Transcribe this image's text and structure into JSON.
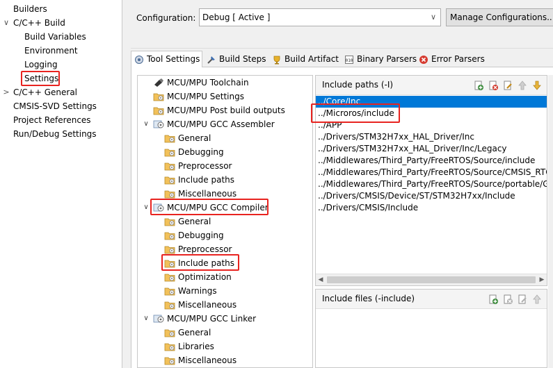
{
  "left_nav": {
    "items": [
      {
        "label": "Builders",
        "indent": 0,
        "arrow": ""
      },
      {
        "label": "C/C++ Build",
        "indent": 0,
        "arrow": "∨"
      },
      {
        "label": "Build Variables",
        "indent": 1,
        "arrow": ""
      },
      {
        "label": "Environment",
        "indent": 1,
        "arrow": ""
      },
      {
        "label": "Logging",
        "indent": 1,
        "arrow": ""
      },
      {
        "label": "Settings",
        "indent": 1,
        "arrow": "",
        "highlight": true
      },
      {
        "label": "C/C++ General",
        "indent": 0,
        "arrow": ">"
      },
      {
        "label": "CMSIS-SVD Settings",
        "indent": 0,
        "arrow": ""
      },
      {
        "label": "Project References",
        "indent": 0,
        "arrow": ""
      },
      {
        "label": "Run/Debug Settings",
        "indent": 0,
        "arrow": ""
      }
    ]
  },
  "config": {
    "label": "Configuration:",
    "value": "Debug  [ Active ]",
    "manage_label": "Manage Configurations..."
  },
  "tabs": [
    {
      "label": "Tool Settings",
      "icon": "tool-settings-icon",
      "active": true
    },
    {
      "label": "Build Steps",
      "icon": "build-steps-icon",
      "active": false
    },
    {
      "label": "Build Artifact",
      "icon": "build-artifact-icon",
      "active": false
    },
    {
      "label": "Binary Parsers",
      "icon": "binary-parsers-icon",
      "active": false
    },
    {
      "label": "Error Parsers",
      "icon": "error-parsers-icon",
      "active": false
    }
  ],
  "tool_tree": [
    {
      "label": "MCU/MPU Toolchain",
      "level": 0,
      "icon": "toolchain-icon",
      "arrow": ""
    },
    {
      "label": "MCU/MPU Settings",
      "level": 0,
      "icon": "settings-folder-icon",
      "arrow": ""
    },
    {
      "label": "MCU/MPU Post build outputs",
      "level": 0,
      "icon": "settings-folder-icon",
      "arrow": ""
    },
    {
      "label": "MCU/MPU GCC Assembler",
      "level": 0,
      "icon": "gear-tool-icon",
      "arrow": "∨"
    },
    {
      "label": "General",
      "level": 1,
      "icon": "settings-folder-icon",
      "arrow": ""
    },
    {
      "label": "Debugging",
      "level": 1,
      "icon": "settings-folder-icon",
      "arrow": ""
    },
    {
      "label": "Preprocessor",
      "level": 1,
      "icon": "settings-folder-icon",
      "arrow": ""
    },
    {
      "label": "Include paths",
      "level": 1,
      "icon": "settings-folder-icon",
      "arrow": ""
    },
    {
      "label": "Miscellaneous",
      "level": 1,
      "icon": "settings-folder-icon",
      "arrow": ""
    },
    {
      "label": "MCU/MPU GCC Compiler",
      "level": 0,
      "icon": "gear-tool-icon",
      "arrow": "∨",
      "highlight": true
    },
    {
      "label": "General",
      "level": 1,
      "icon": "settings-folder-icon",
      "arrow": ""
    },
    {
      "label": "Debugging",
      "level": 1,
      "icon": "settings-folder-icon",
      "arrow": ""
    },
    {
      "label": "Preprocessor",
      "level": 1,
      "icon": "settings-folder-icon",
      "arrow": ""
    },
    {
      "label": "Include paths",
      "level": 1,
      "icon": "settings-folder-icon",
      "arrow": "",
      "highlight": true
    },
    {
      "label": "Optimization",
      "level": 1,
      "icon": "settings-folder-icon",
      "arrow": ""
    },
    {
      "label": "Warnings",
      "level": 1,
      "icon": "settings-folder-icon",
      "arrow": ""
    },
    {
      "label": "Miscellaneous",
      "level": 1,
      "icon": "settings-folder-icon",
      "arrow": ""
    },
    {
      "label": "MCU/MPU GCC Linker",
      "level": 0,
      "icon": "gear-tool-icon",
      "arrow": "∨"
    },
    {
      "label": "General",
      "level": 1,
      "icon": "settings-folder-icon",
      "arrow": ""
    },
    {
      "label": "Libraries",
      "level": 1,
      "icon": "settings-folder-icon",
      "arrow": ""
    },
    {
      "label": "Miscellaneous",
      "level": 1,
      "icon": "settings-folder-icon",
      "arrow": ""
    }
  ],
  "include_paths": {
    "title": "Include paths (-I)",
    "tools": [
      "add-icon",
      "delete-icon",
      "edit-icon",
      "move-up-icon",
      "move-down-icon"
    ],
    "items": [
      {
        "path": "../Core/Inc",
        "selected": true
      },
      {
        "path": "../Microros/include",
        "selected": false,
        "highlight": true
      },
      {
        "path": "../APP",
        "selected": false
      },
      {
        "path": "../Drivers/STM32H7xx_HAL_Driver/Inc",
        "selected": false
      },
      {
        "path": "../Drivers/STM32H7xx_HAL_Driver/Inc/Legacy",
        "selected": false
      },
      {
        "path": "../Middlewares/Third_Party/FreeRTOS/Source/include",
        "selected": false
      },
      {
        "path": "../Middlewares/Third_Party/FreeRTOS/Source/CMSIS_RTOS",
        "selected": false
      },
      {
        "path": "../Middlewares/Third_Party/FreeRTOS/Source/portable/GCC",
        "selected": false
      },
      {
        "path": "../Drivers/CMSIS/Device/ST/STM32H7xx/Include",
        "selected": false
      },
      {
        "path": "../Drivers/CMSIS/Include",
        "selected": false
      }
    ]
  },
  "include_files": {
    "title": "Include files (-include)",
    "tools": [
      "add-icon",
      "delete-icon",
      "edit-icon",
      "move-up-icon"
    ]
  },
  "colors": {
    "highlight": "#e8231f",
    "selection": "#0078d7",
    "folder": "#e8b54a"
  }
}
